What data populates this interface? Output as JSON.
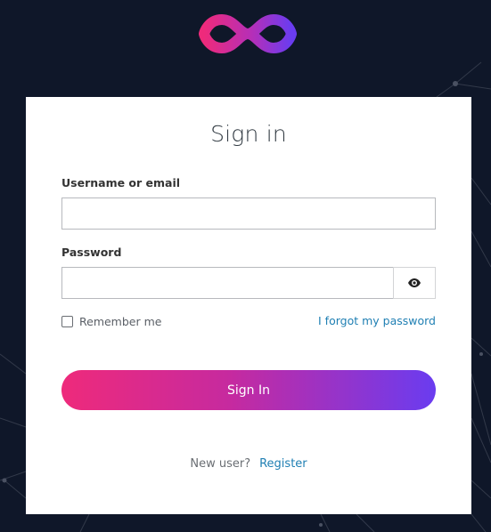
{
  "colors": {
    "background": "#0f1729",
    "card": "#ffffff",
    "accent_pink": "#ee2a7b",
    "accent_purple": "#6a3cf0",
    "link": "#1f7fb3"
  },
  "logo": {
    "icon": "infinity-logo-icon"
  },
  "form": {
    "title": "Sign in",
    "username_label": "Username or email",
    "username_value": "",
    "password_label": "Password",
    "password_value": "",
    "show_password_icon": "eye-icon",
    "remember_label": "Remember me",
    "remember_checked": false,
    "forgot_link": "I forgot my password",
    "submit_label": "Sign In"
  },
  "footer": {
    "new_user_text": "New user?",
    "register_link": "Register"
  }
}
